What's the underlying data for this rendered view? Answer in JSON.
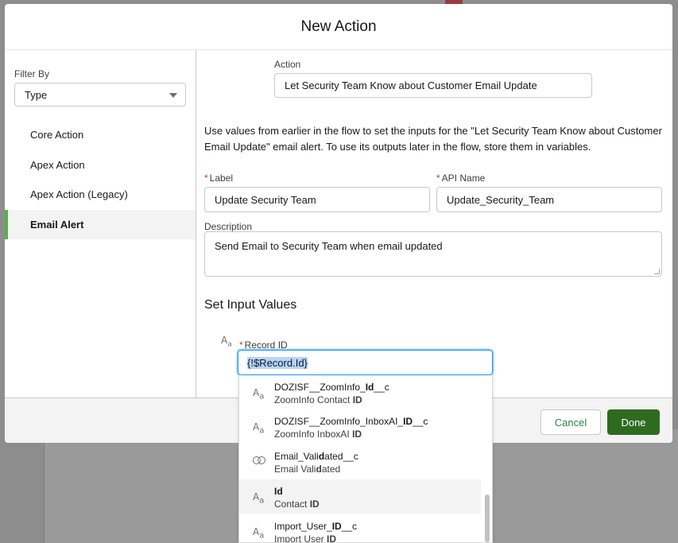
{
  "modal": {
    "title": "New Action"
  },
  "sidebar": {
    "filter_label": "Filter By",
    "filter_value": "Type",
    "items": [
      {
        "label": "Core Action",
        "active": false
      },
      {
        "label": "Apex Action",
        "active": false
      },
      {
        "label": "Apex Action (Legacy)",
        "active": false
      },
      {
        "label": "Email Alert",
        "active": true
      }
    ]
  },
  "form": {
    "action_label": "Action",
    "action_value": "Let Security Team Know about Customer Email Update",
    "help_text": "Use values from earlier in the flow to set the inputs for the \"Let Security Team Know about Customer Email Update\" email alert. To use its outputs later in the flow, store them in variables.",
    "label_label": "Label",
    "label_value": "Update Security Team",
    "api_name_label": "API Name",
    "api_name_value": "Update_Security_Team",
    "description_label": "Description",
    "description_value": "Send Email to Security Team when email updated",
    "set_input_title": "Set Input Values",
    "record_id_label": "Record ID",
    "record_id_value": "{!$Record.Id}",
    "required_mark": "*"
  },
  "footer": {
    "cancel_label": "Cancel",
    "done_label": "Done"
  },
  "dropdown": {
    "items": [
      {
        "icon": "text-type-icon",
        "l1": [
          "DOZISF__ZoomInfo_",
          "Id",
          "__c"
        ],
        "l2": [
          "ZoomInfo Contact ",
          "ID",
          ""
        ]
      },
      {
        "icon": "text-type-icon",
        "l1": [
          "DOZISF__ZoomInfo_InboxAI_",
          "ID",
          "__c"
        ],
        "l2": [
          "ZoomInfo InboxAI ",
          "ID",
          ""
        ]
      },
      {
        "icon": "checkbox-type-icon",
        "l1": [
          "Email_Vali",
          "d",
          "ated__c"
        ],
        "l2": [
          "Email Vali",
          "d",
          "ated"
        ]
      },
      {
        "icon": "text-type-icon",
        "l1": [
          "",
          "Id",
          ""
        ],
        "l2": [
          "Contact ",
          "ID",
          ""
        ]
      },
      {
        "icon": "text-type-icon",
        "l1": [
          "Import_User_",
          "ID",
          "__c"
        ],
        "l2": [
          "Import User ",
          "ID",
          ""
        ]
      }
    ]
  },
  "colors": {
    "brand_green": "#2e6b20",
    "active_accent": "#58b04a",
    "focus_blue": "#1b96ff"
  }
}
